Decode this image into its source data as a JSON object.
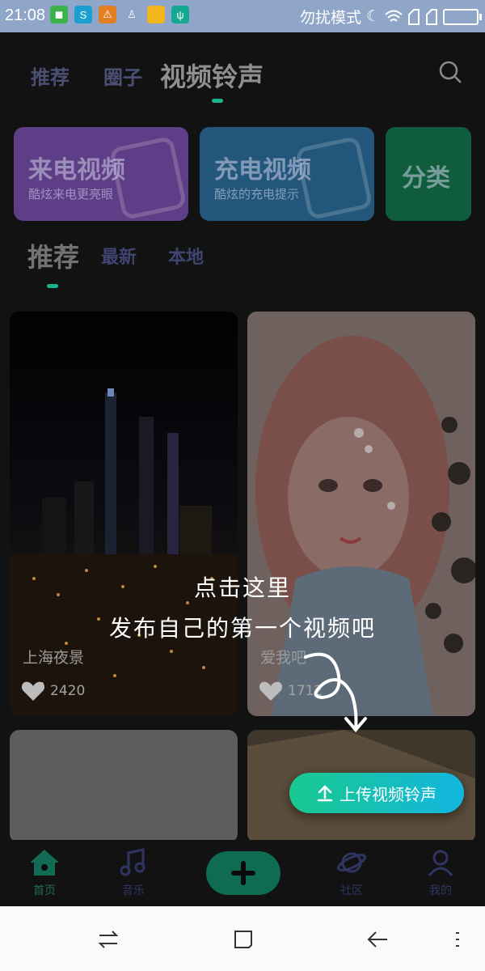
{
  "statusbar": {
    "time": "21:08",
    "mode_text": "勿扰模式"
  },
  "topnav": {
    "tabs": [
      {
        "label": "推荐"
      },
      {
        "label": "圈子"
      },
      {
        "label": "视频铃声"
      }
    ]
  },
  "cards": [
    {
      "title": "来电视频",
      "subtitle": "酷炫来电更亮眼",
      "color": "#5e3e86"
    },
    {
      "title": "充电视频",
      "subtitle": "酷炫的充电提示",
      "color": "#22567a"
    },
    {
      "title": "分类",
      "subtitle": "",
      "color": "#0f5d3c"
    }
  ],
  "subtabs": [
    {
      "label": "推荐"
    },
    {
      "label": "最新"
    },
    {
      "label": "本地"
    }
  ],
  "videos": [
    {
      "title": "上海夜景",
      "likes": "2420"
    },
    {
      "title": "爱我吧",
      "likes": "1712"
    }
  ],
  "guide": {
    "line1": "点击这里",
    "line2": "发布自己的第一个视频吧"
  },
  "upload": {
    "label": "上传视频铃声"
  },
  "bottomnav": {
    "items": [
      {
        "label": "首页"
      },
      {
        "label": "音乐"
      },
      {
        "label": ""
      },
      {
        "label": "社区"
      },
      {
        "label": "我的"
      }
    ]
  },
  "colors": {
    "accent": "#1ab38d",
    "upload_start": "#19c98e",
    "upload_end": "#12b6e0"
  }
}
